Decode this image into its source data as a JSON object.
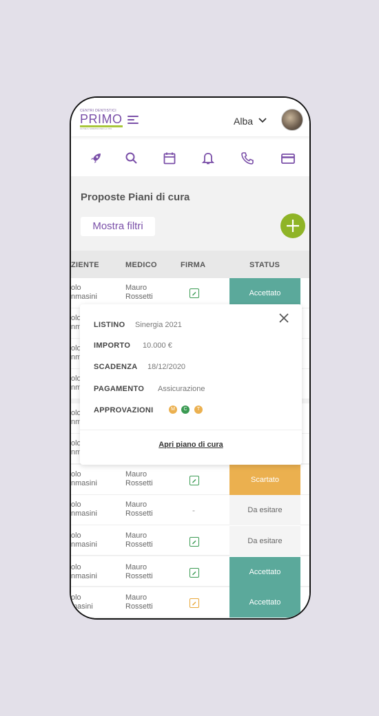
{
  "header": {
    "logo_top": "CENTRI DENTISTICI",
    "logo_main": "PRIMO",
    "logo_sub": "OLTRE IL SORRISO PER LA VITA",
    "user_name": "Alba"
  },
  "icon_bar": [
    "rocket-icon",
    "search-icon",
    "calendar-icon",
    "bell-icon",
    "phone-icon",
    "credit-card-icon"
  ],
  "page": {
    "title": "Proposte Piani di cura",
    "filter_label": "Mostra filtri"
  },
  "table": {
    "headers": [
      "ZIENTE",
      "MEDICO",
      "FIRMA",
      "STATUS"
    ],
    "rows": [
      {
        "patient1": "olo",
        "patient2": "nmasini",
        "doctor1": "Mauro",
        "doctor2": "Rossetti",
        "sign": "green",
        "status": "Accettato"
      },
      {
        "patient1": "olo",
        "patient2": "nm",
        "doctor1": "",
        "doctor2": "",
        "sign": "",
        "status": ""
      },
      {
        "patient1": "olo",
        "patient2": "nm",
        "doctor1": "",
        "doctor2": "",
        "sign": "",
        "status": ""
      },
      {
        "patient1": "olo",
        "patient2": "nm",
        "doctor1": "",
        "doctor2": "",
        "sign": "",
        "status": ""
      },
      {
        "patient1": "olo",
        "patient2": "nm",
        "doctor1": "",
        "doctor2": "",
        "sign": "",
        "status": ""
      },
      {
        "patient1": "olo",
        "patient2": "nm",
        "doctor1": "",
        "doctor2": "",
        "sign": "",
        "status": ""
      },
      {
        "patient1": "olo",
        "patient2": "nmasini",
        "doctor1": "Mauro",
        "doctor2": "Rossetti",
        "sign": "green",
        "status": "Scartato"
      },
      {
        "patient1": "olo",
        "patient2": "nmasini",
        "doctor1": "Mauro",
        "doctor2": "Rossetti",
        "sign": "-",
        "status": "Da esitare"
      },
      {
        "patient1": "olo",
        "patient2": "nmasini",
        "doctor1": "Mauro",
        "doctor2": "Rossetti",
        "sign": "green",
        "status": "Da esitare"
      },
      {
        "patient1": "olo",
        "patient2": "nmasini",
        "doctor1": "Mauro",
        "doctor2": "Rossetti",
        "sign": "green",
        "status": "Accettato"
      },
      {
        "patient1": "olo",
        "patient2": "masini",
        "doctor1": "Mauro",
        "doctor2": "Rossetti",
        "sign": "orange",
        "status": "Accettato"
      }
    ]
  },
  "popup": {
    "listino_label": "LISTINO",
    "listino_value": "Sinergia 2021",
    "importo_label": "IMPORTO",
    "importo_value": "10.000 €",
    "scadenza_label": "SCADENZA",
    "scadenza_value": "18/12/2020",
    "pagamento_label": "PAGAMENTO",
    "pagamento_value": "Assicurazione",
    "approvazioni_label": "APPROVAZIONI",
    "badges": [
      {
        "letter": "M",
        "color": "#ebb04f"
      },
      {
        "letter": "C",
        "color": "#3a9a52"
      },
      {
        "letter": "T",
        "color": "#ebb04f"
      }
    ],
    "link": "Apri piano di cura"
  },
  "colors": {
    "brand_purple": "#7a4fa8",
    "accent_green": "#8fb427",
    "accepted": "#5ba99b",
    "rejected": "#ebb04f"
  }
}
